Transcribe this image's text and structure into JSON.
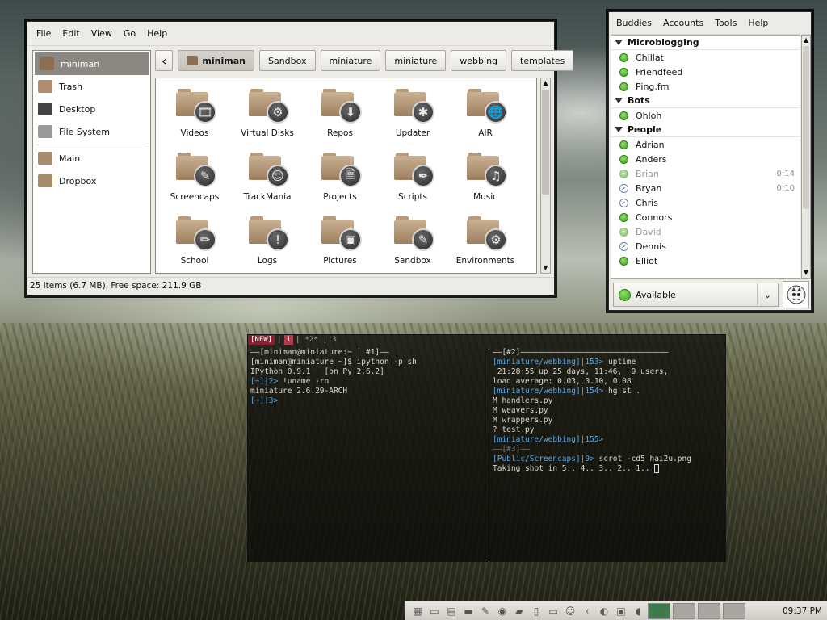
{
  "file_manager": {
    "menu": [
      "File",
      "Edit",
      "View",
      "Go",
      "Help"
    ],
    "places": [
      {
        "label": "miniman",
        "icon": "home-folder-icon",
        "selected": true
      },
      {
        "label": "Trash",
        "icon": "trash-icon"
      },
      {
        "label": "Desktop",
        "icon": "desktop-icon"
      },
      {
        "label": "File System",
        "icon": "harddisk-icon"
      }
    ],
    "bookmarks": [
      {
        "label": "Main",
        "icon": "folder-icon"
      },
      {
        "label": "Dropbox",
        "icon": "folder-icon"
      }
    ],
    "path_buttons": [
      "miniman",
      "Sandbox",
      "miniature",
      "miniature",
      "webbing",
      "templates"
    ],
    "items": [
      {
        "label": "Videos",
        "emblem": "🎞"
      },
      {
        "label": "Virtual Disks",
        "emblem": "⚙"
      },
      {
        "label": "Repos",
        "emblem": "⬇"
      },
      {
        "label": "Updater",
        "emblem": "✱"
      },
      {
        "label": "AIR",
        "emblem": "🌐"
      },
      {
        "label": "Screencaps",
        "emblem": "✎"
      },
      {
        "label": "TrackMania",
        "emblem": "☺"
      },
      {
        "label": "Projects",
        "emblem": "🗎"
      },
      {
        "label": "Scripts",
        "emblem": "✒"
      },
      {
        "label": "Music",
        "emblem": "♫"
      },
      {
        "label": "School",
        "emblem": "✏"
      },
      {
        "label": "Logs",
        "emblem": "!"
      },
      {
        "label": "Pictures",
        "emblem": "▣"
      },
      {
        "label": "Sandbox",
        "emblem": "✎"
      },
      {
        "label": "Environments",
        "emblem": "⚙"
      }
    ],
    "status": "25 items (6.7 MB), Free space: 211.9 GB"
  },
  "pidgin": {
    "menu": [
      "Buddies",
      "Accounts",
      "Tools",
      "Help"
    ],
    "groups": [
      {
        "name": "Microblogging",
        "buddies": [
          {
            "name": "Chillat",
            "state": "on"
          },
          {
            "name": "Friendfeed",
            "state": "on"
          },
          {
            "name": "Ping.fm",
            "state": "on"
          }
        ]
      },
      {
        "name": "Bots",
        "buddies": [
          {
            "name": "Ohloh",
            "state": "on"
          }
        ]
      },
      {
        "name": "People",
        "buddies": [
          {
            "name": "Adrian",
            "state": "on"
          },
          {
            "name": "Anders",
            "state": "on"
          },
          {
            "name": "Brian",
            "state": "idle",
            "idle": "0:14"
          },
          {
            "name": "Bryan",
            "state": "away",
            "idle": "0:10"
          },
          {
            "name": "Chris",
            "state": "away"
          },
          {
            "name": "Connors",
            "state": "on"
          },
          {
            "name": "David",
            "state": "idle"
          },
          {
            "name": "Dennis",
            "state": "away"
          },
          {
            "name": "Elliot",
            "state": "on"
          }
        ]
      }
    ],
    "status": "Available"
  },
  "terminal": {
    "tabs": [
      "[NEW]",
      "1",
      "*2*",
      "3"
    ],
    "left_title": "——[miniman@miniature:~ | #1]——",
    "left_lines": [
      "[miniman@miniature ~]$ ipython -p sh",
      "IPython 0.9.1   [on Py 2.6.2]",
      "[~]|2> !uname -rn",
      "miniature 2.6.29-ARCH",
      "[~]|3>"
    ],
    "right_title": "——[#2]————————————————————————————————",
    "right_lines": [
      "[miniature/webbing]|153> uptime",
      " 21:28:55 up 25 days, 11:46,  9 users,",
      "load average: 0.03, 0.10, 0.08",
      "[miniature/webbing]|154> hg st .",
      "M handlers.py",
      "M weavers.py",
      "M wrappers.py",
      "? test.py",
      "[miniature/webbing]|155>"
    ],
    "right_title2": "——[#3]——",
    "right_lines2": [
      "[Public/Screencaps]|9> scrot -cd5 hai2u.png",
      "Taking shot in 5.. 4.. 3.. 2.. 1.. "
    ]
  },
  "panel": {
    "clock": "09:37 PM"
  }
}
